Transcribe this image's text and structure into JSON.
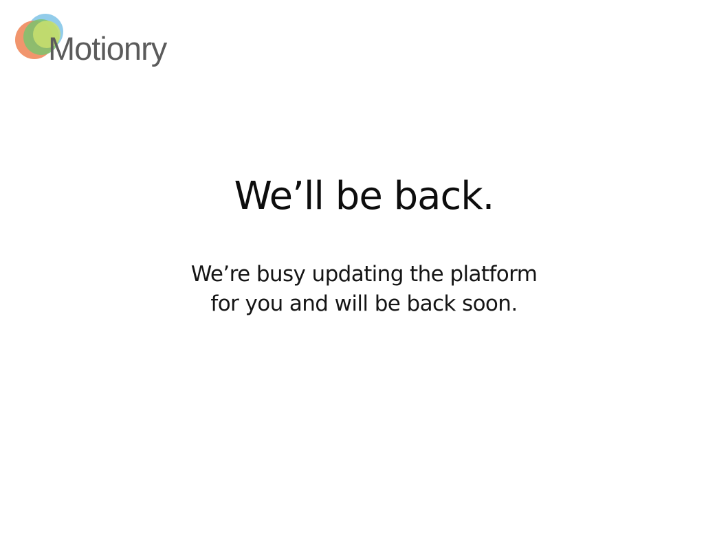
{
  "brand": {
    "name": "Motionry",
    "colors": {
      "orange": "#f08a5d",
      "green": "#7cc36e",
      "lime": "#c9df6e",
      "blue": "#7fc3e6",
      "text": "#5b5b5b"
    }
  },
  "main": {
    "headline": "We’ll be back.",
    "message_lines": [
      "We’re busy updating the platform",
      "for you and will be back soon."
    ]
  }
}
